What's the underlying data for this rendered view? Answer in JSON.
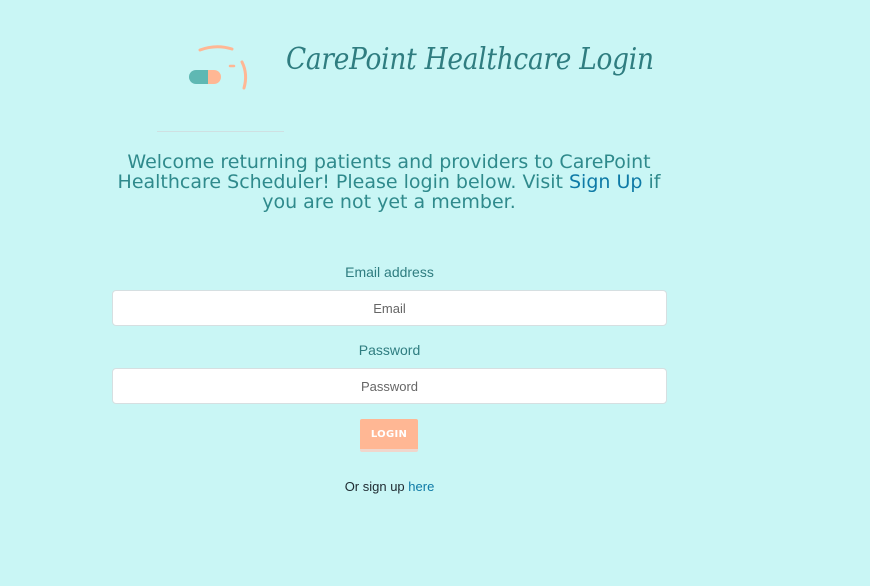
{
  "header": {
    "title": "CarePoint Healthcare Login",
    "logo_icon": "pill-capsule-icon"
  },
  "welcome": {
    "text_before": "Welcome returning patients and providers to CarePoint Healthcare Scheduler! Please login below. Visit ",
    "link_label": "Sign Up",
    "text_after": " if you are not yet a member."
  },
  "form": {
    "email_label": "Email address",
    "email_placeholder": "Email",
    "email_value": "",
    "password_label": "Password",
    "password_placeholder": "Password",
    "password_value": "",
    "login_label": "LOGIN"
  },
  "signup": {
    "prefix": "Or sign up ",
    "link_label": "here"
  },
  "colors": {
    "background": "#c9f6f5",
    "primary_text": "#2f7d80",
    "link": "#0e7aa6",
    "button": "#ffb794"
  }
}
